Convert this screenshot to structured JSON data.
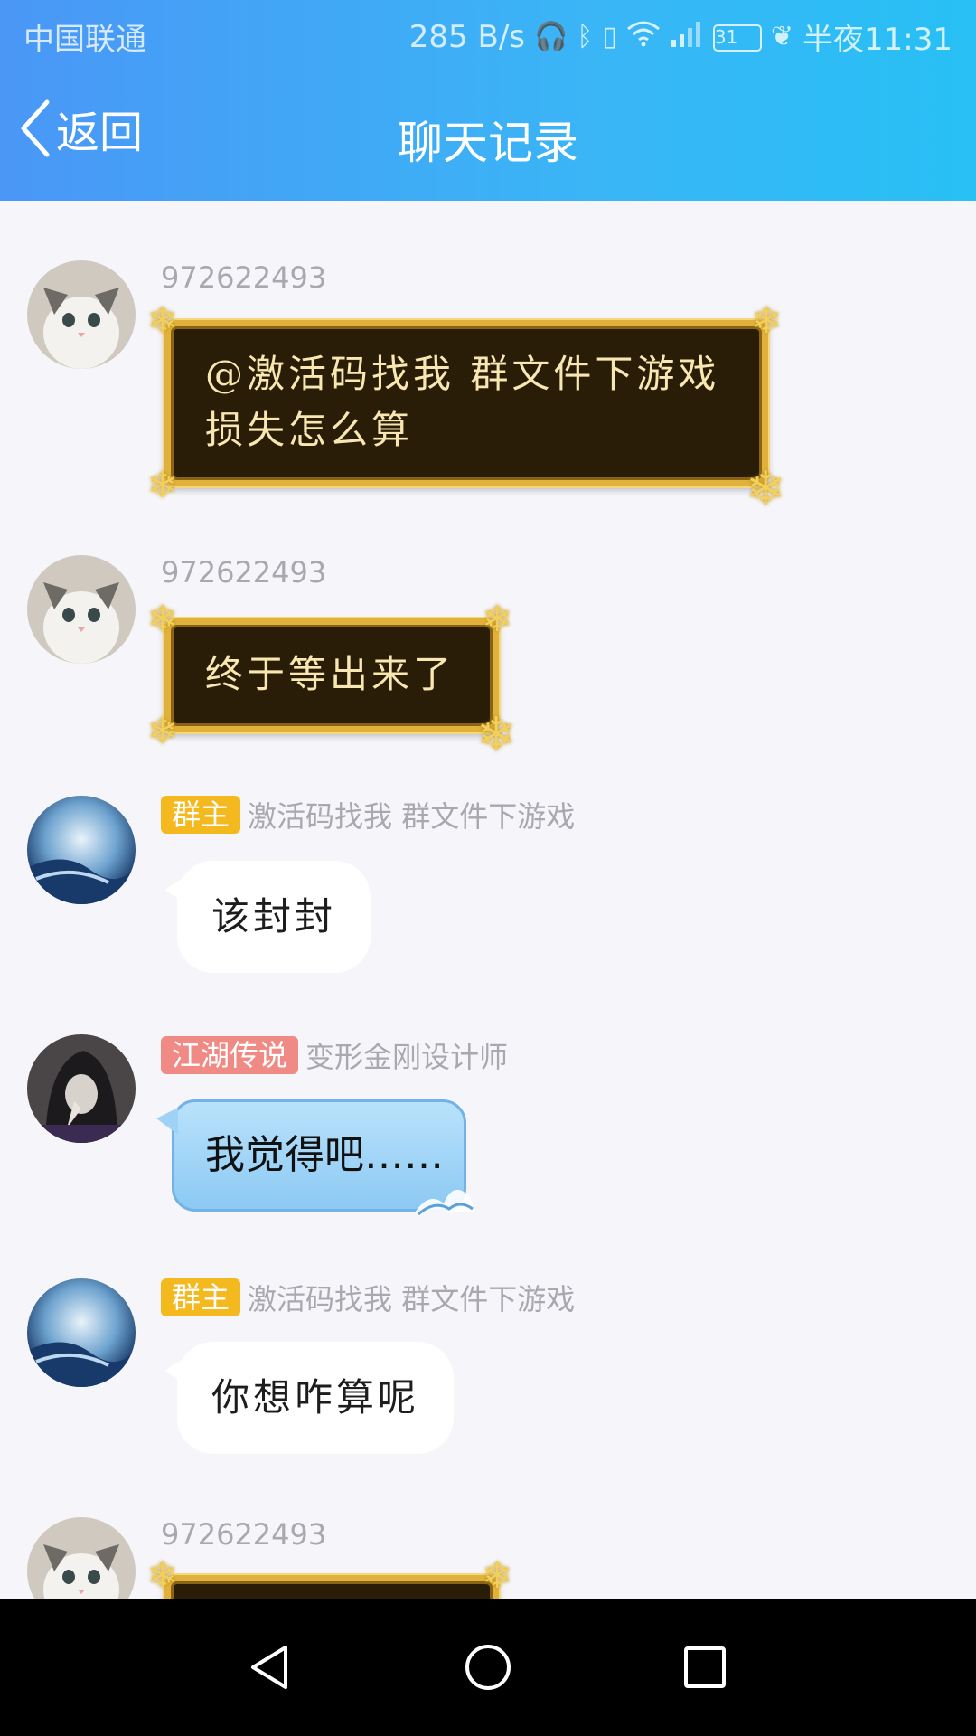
{
  "status_bar": {
    "carrier": "中国联通",
    "speed": "285 B/s",
    "battery": "31",
    "time": "半夜11:31"
  },
  "nav": {
    "back_label": "返回",
    "title": "聊天记录"
  },
  "messages": [
    {
      "sender": "972622493",
      "text_line1": "@激活码找我 群文件下游戏",
      "text_line2": "损失怎么算"
    },
    {
      "sender": "972622493",
      "text": "终于等出来了"
    },
    {
      "badge": "群主",
      "sender": "激活码找我 群文件下游戏",
      "text": "该封封"
    },
    {
      "badge": "江湖传说",
      "sender": "变形金刚设计师",
      "text": "我觉得吧……"
    },
    {
      "badge": "群主",
      "sender": "激活码找我 群文件下游戏",
      "text": "你想咋算呢"
    },
    {
      "sender": "972622493"
    }
  ],
  "colors": {
    "header_start": "#4a97f6",
    "header_end": "#27c0f5",
    "owner_badge": "#f5b920",
    "legend_badge": "#f08a85"
  }
}
